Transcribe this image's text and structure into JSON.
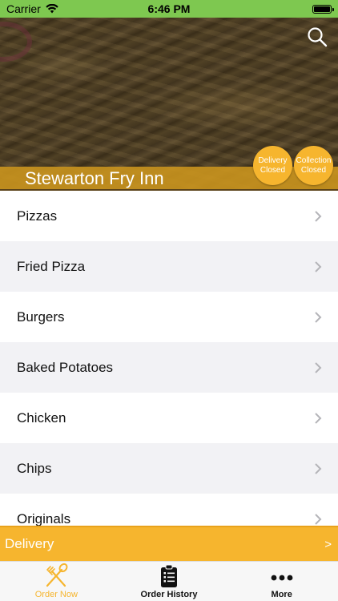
{
  "status_bar": {
    "carrier": "Carrier",
    "time": "6:46 PM"
  },
  "header": {
    "restaurant_name": "Stewarton Fry Inn",
    "delivery_badge": {
      "line1": "Delivery",
      "line2": "Closed"
    },
    "collection_badge": {
      "line1": "Collection",
      "line2": "Closed"
    }
  },
  "menu": {
    "items": [
      {
        "label": "Pizzas"
      },
      {
        "label": "Fried Pizza"
      },
      {
        "label": "Burgers"
      },
      {
        "label": "Baked Potatoes"
      },
      {
        "label": "Chicken"
      },
      {
        "label": "Chips"
      },
      {
        "label": "Originals"
      }
    ]
  },
  "delivery_bar": {
    "label": "Delivery",
    "arrow": ">"
  },
  "tabs": [
    {
      "label": "Order Now",
      "icon": "fork-spoon-icon",
      "active": true
    },
    {
      "label": "Order History",
      "icon": "clipboard-list-icon",
      "active": false
    },
    {
      "label": "More",
      "icon": "more-dots-icon",
      "active": false
    }
  ],
  "colors": {
    "accent": "#f6b52e",
    "status_bar": "#7ec850",
    "title_band": "#cd961e"
  }
}
